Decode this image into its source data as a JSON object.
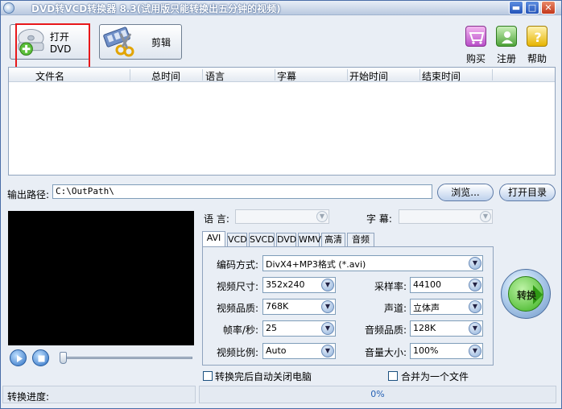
{
  "window": {
    "title": "DVD转VCD转换器 8.3(试用版只能转换出五分钟的视频)",
    "min_glyph": "▬",
    "max_glyph": "□",
    "close_glyph": "✕"
  },
  "toolbar": {
    "open_dvd_label": "打开DVD",
    "cut_label": "剪辑",
    "buy_label": "购买",
    "register_label": "注册",
    "help_label": "帮助"
  },
  "file_list": {
    "columns": [
      "文件名",
      "总时间",
      "语言",
      "字幕",
      "开始时间",
      "结束时间"
    ],
    "rows": []
  },
  "output": {
    "label": "输出路径:",
    "path": "C:\\OutPath\\",
    "browse_label": "浏览...",
    "open_dir_label": "打开目录"
  },
  "track": {
    "language_label": "语 言:",
    "language_value": "",
    "subtitle_label": "字 幕:",
    "subtitle_value": ""
  },
  "tabs": [
    "AVI",
    "VCD",
    "SVCD",
    "DVD",
    "WMV",
    "高清",
    "音频"
  ],
  "active_tab": "AVI",
  "settings": {
    "encoding_label": "编码方式:",
    "encoding_value": "DivX4+MP3格式 (*.avi)",
    "video_size_label": "视频尺寸:",
    "video_size_value": "352x240",
    "video_quality_label": "视频品质:",
    "video_quality_value": "768K",
    "frame_rate_label": "帧率/秒:",
    "frame_rate_value": "25",
    "aspect_label": "视频比例:",
    "aspect_value": "Auto",
    "sample_rate_label": "采样率:",
    "sample_rate_value": "44100",
    "channel_label": "声道:",
    "channel_value": "立体声",
    "audio_quality_label": "音频品质:",
    "audio_quality_value": "128K",
    "volume_label": "音量大小:",
    "volume_value": "100%"
  },
  "convert_label": "转换",
  "options": {
    "shutdown_label": "转换完后自动关闭电脑",
    "merge_label": "合并为一个文件"
  },
  "status": {
    "progress_label": "转换进度:",
    "progress_text": "0%",
    "progress": 0
  },
  "colors": {
    "highlight_box": "#e8181a",
    "convert_green": "#3bb11e",
    "progress_text": "#2561b5"
  }
}
